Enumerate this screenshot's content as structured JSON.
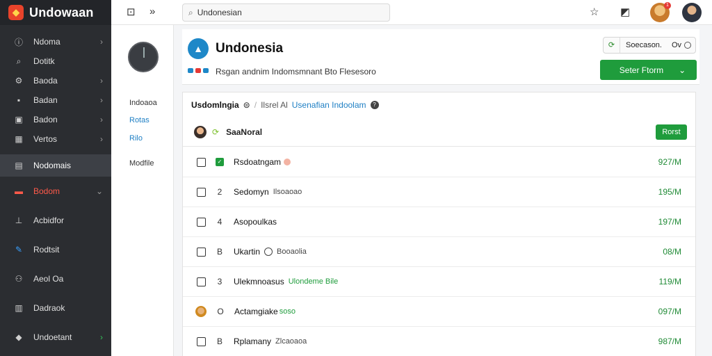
{
  "app": {
    "name": "Undowaan"
  },
  "topbar": {
    "search_value": "Undonesian"
  },
  "notifications": {
    "count": "1"
  },
  "sidebar": {
    "items": [
      {
        "label": "Ndoma",
        "icon": "info-icon"
      },
      {
        "label": "Dotitk",
        "icon": "search-icon"
      },
      {
        "label": "Baoda",
        "icon": "settings-icon"
      },
      {
        "label": "Badan",
        "icon": "tag-icon"
      },
      {
        "label": "Badon",
        "icon": "box-icon"
      },
      {
        "label": "Vertos",
        "icon": "grid-icon"
      },
      {
        "label": "Nodomais",
        "icon": "table-icon"
      },
      {
        "label": "Bodom",
        "icon": "briefcase-icon"
      },
      {
        "label": "Acbidfor",
        "icon": "upload-icon"
      },
      {
        "label": "Rodtsit",
        "icon": "edit-icon"
      },
      {
        "label": "Aeol Oa",
        "icon": "users-icon"
      },
      {
        "label": "Dadraok",
        "icon": "print-icon"
      },
      {
        "label": "Undoetant",
        "icon": "diamond-icon"
      }
    ]
  },
  "subpanel": {
    "links": [
      "Indoaoa",
      "Rotas",
      "Rilo",
      "Modfile"
    ]
  },
  "header": {
    "title": "Undonesia",
    "subtitle": "Rsgan andnim Indomsmnant Bto Flesesoro",
    "status_label": "Soecason.",
    "status_value": "Ov",
    "action_label": "Seter Ftorm"
  },
  "breadcrumb": {
    "root": "Usdomlngia",
    "mid": "Ilsrel Al",
    "link": "Usenafian Indoolam"
  },
  "list": {
    "title": "SaaNoral",
    "new_label": "Rorst",
    "rows": [
      {
        "glyph": "✓",
        "name": "Rsdoatngam",
        "sub": "",
        "value": "927/M"
      },
      {
        "glyph": "2",
        "name": "Sedomyn",
        "sub": "Ilsoaoao",
        "value": "195/M"
      },
      {
        "glyph": "4",
        "name": "Asopoulkas",
        "sub": "",
        "value": "197/M"
      },
      {
        "glyph": "B",
        "name": "Ukartin",
        "sub": "Booaolia",
        "value": "08/M"
      },
      {
        "glyph": "3",
        "name": "Ulekmnoasus",
        "sub": "Ulondeme Bile",
        "value": "119/M"
      },
      {
        "glyph": "O",
        "name": "Actamgiake",
        "sub": "soso",
        "value": "097/M"
      },
      {
        "glyph": "B",
        "name": "Rplamany",
        "sub": "Zlcaoaoa",
        "value": "987/M"
      }
    ]
  }
}
